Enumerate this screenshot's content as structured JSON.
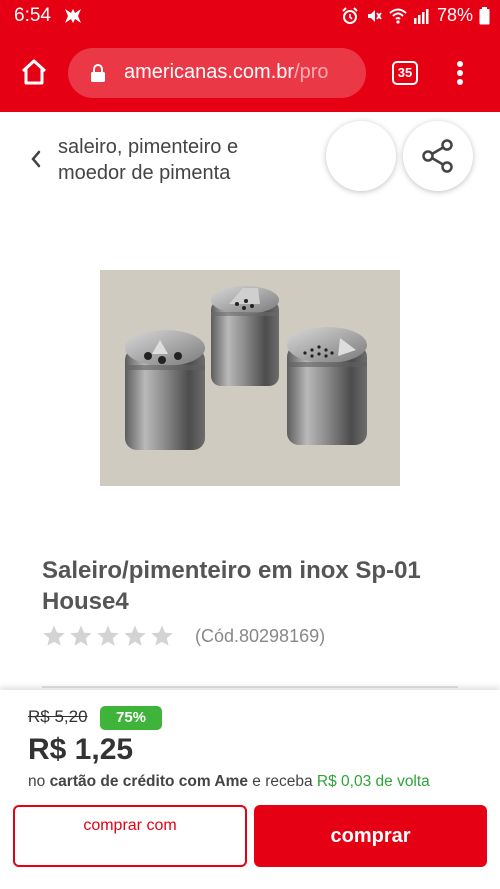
{
  "status_bar": {
    "time": "6:54",
    "battery": "78%",
    "icons": [
      "app-notification-icon",
      "alarm-icon",
      "mute-icon",
      "wifi-icon",
      "signal-icon",
      "battery-icon"
    ]
  },
  "browser": {
    "url_main": "americanas.com.br",
    "url_rest": "/pro",
    "tab_count": "35",
    "icons": [
      "home-icon",
      "lock-icon",
      "more-vert-icon"
    ]
  },
  "header": {
    "breadcrumb": "saleiro, pimenteiro e moedor de pimenta",
    "icons": [
      "chevron-left-icon",
      "share-icon"
    ]
  },
  "product": {
    "title": "Saleiro/pimenteiro em inox Sp-01 House4",
    "rating_stars": 0,
    "rating_max": 5,
    "code": "(Cód.80298169)"
  },
  "pricing": {
    "old_price": "R$ 5,20",
    "discount": "75%",
    "price": "R$ 1,25",
    "note_prefix": "no",
    "note_bold": "cartão de crédito com Ame",
    "note_middle": "e receba",
    "cashback": "R$ 0,03 de volta"
  },
  "actions": {
    "secondary_label": "comprar com",
    "primary_label": "comprar"
  },
  "colors": {
    "brand_red": "#e60014",
    "discount_green": "#3fb43a",
    "cashback_green": "#2ea43a"
  }
}
